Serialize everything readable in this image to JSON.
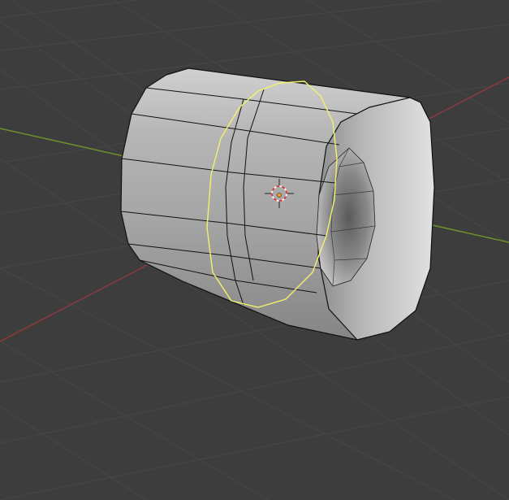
{
  "viewport": {
    "mode": "edit-mode",
    "selection": "edge-loop",
    "background_color": "#3d3d3d",
    "grid_color": "#474747",
    "x_axis_color": "#8b3a3c",
    "y_axis_color": "#6c8f2c",
    "object_fill": "#a7a7a7",
    "edge_color": "#111111",
    "selected_edge_color": "#f2f26a"
  },
  "object": {
    "type": "cylinder",
    "selected_loop": "middle-edge-loop"
  },
  "gizmo": {
    "type": "3d-cursor"
  }
}
